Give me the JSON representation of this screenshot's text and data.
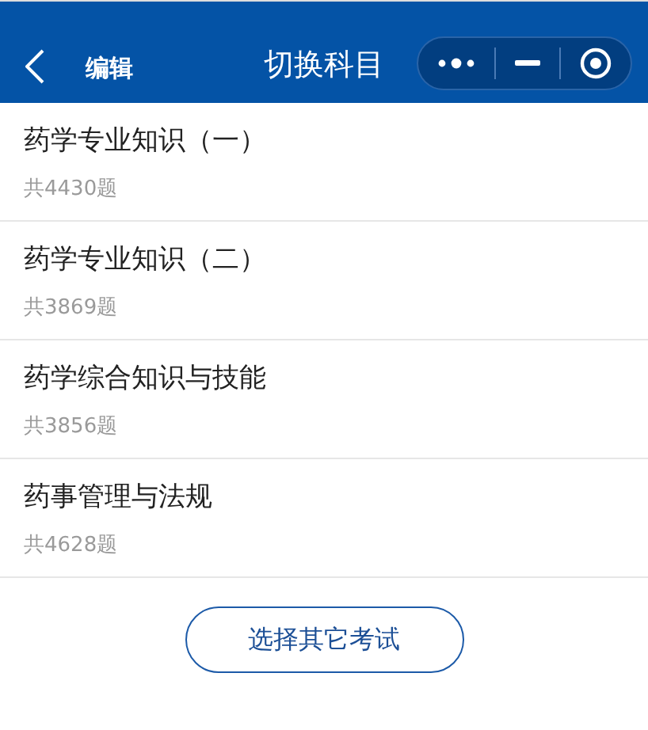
{
  "nav_bar": {
    "edit": "编辑",
    "title": "切换科目"
  },
  "subjects": [
    {
      "name": "药学专业知识（一）",
      "count": "共4430题"
    },
    {
      "name": "药学专业知识（二）",
      "count": "共3869题"
    },
    {
      "name": "药学综合知识与技能",
      "count": "共3856题"
    },
    {
      "name": "药事管理与法规",
      "count": "共4628题"
    }
  ],
  "other_exam_button": "选择其它考试"
}
